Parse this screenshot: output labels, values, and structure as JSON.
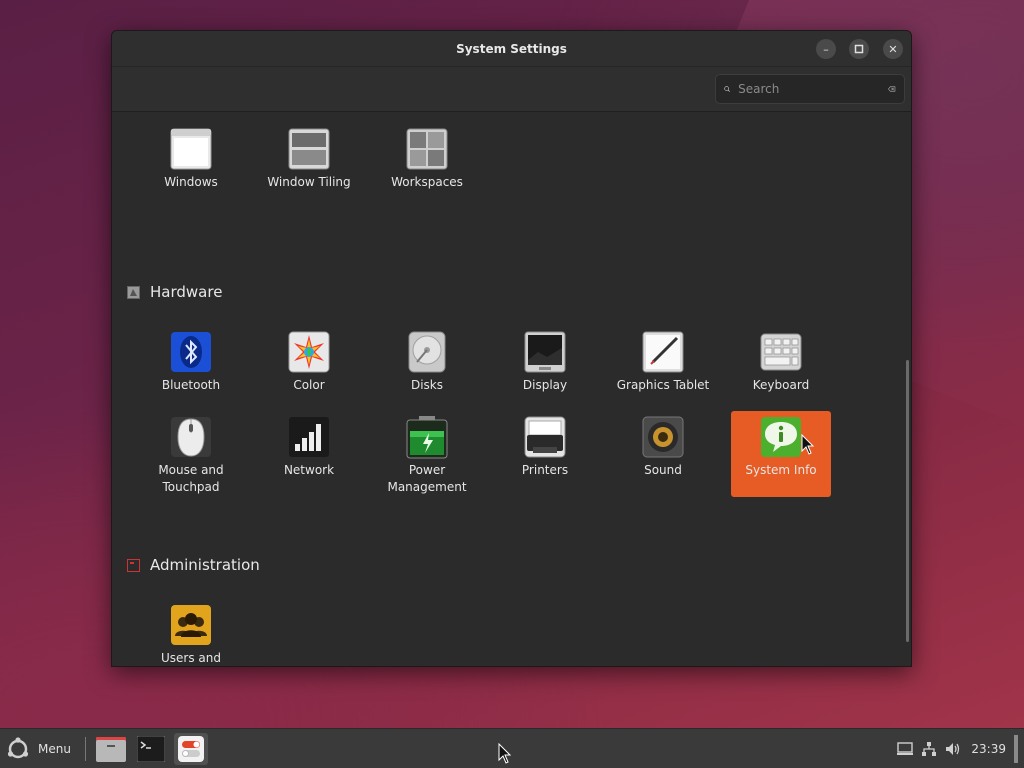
{
  "window": {
    "title": "System Settings",
    "minimize_label": "–",
    "maximize_label": "□",
    "close_label": "✕"
  },
  "search": {
    "placeholder": "Search"
  },
  "top_items": [
    {
      "label": "Windows",
      "icon": "windows-icon"
    },
    {
      "label": "Window Tiling",
      "icon": "window-tiling-icon"
    },
    {
      "label": "Workspaces",
      "icon": "workspaces-icon"
    }
  ],
  "sections": {
    "hardware": {
      "title": "Hardware",
      "items": [
        {
          "label": "Bluetooth",
          "icon": "bluetooth-icon"
        },
        {
          "label": "Color",
          "icon": "color-icon"
        },
        {
          "label": "Disks",
          "icon": "disks-icon"
        },
        {
          "label": "Display",
          "icon": "display-icon"
        },
        {
          "label": "Graphics Tablet",
          "icon": "graphics-tablet-icon"
        },
        {
          "label": "Keyboard",
          "icon": "keyboard-icon"
        },
        {
          "label": "Mouse and Touchpad",
          "icon": "mouse-icon"
        },
        {
          "label": "Network",
          "icon": "network-icon"
        },
        {
          "label": "Power Management",
          "icon": "power-icon"
        },
        {
          "label": "Printers",
          "icon": "printer-icon"
        },
        {
          "label": "Sound",
          "icon": "sound-icon"
        },
        {
          "label": "System Info",
          "icon": "system-info-icon",
          "selected": true
        }
      ]
    },
    "administration": {
      "title": "Administration",
      "items": [
        {
          "label": "Users and",
          "icon": "users-icon"
        }
      ]
    }
  },
  "taskbar": {
    "menu_label": "Menu",
    "clock": "23:39"
  },
  "colors": {
    "selection": "#e65c24",
    "window_bg": "#2b2b2b",
    "taskbar_bg": "#3a3a3a"
  }
}
